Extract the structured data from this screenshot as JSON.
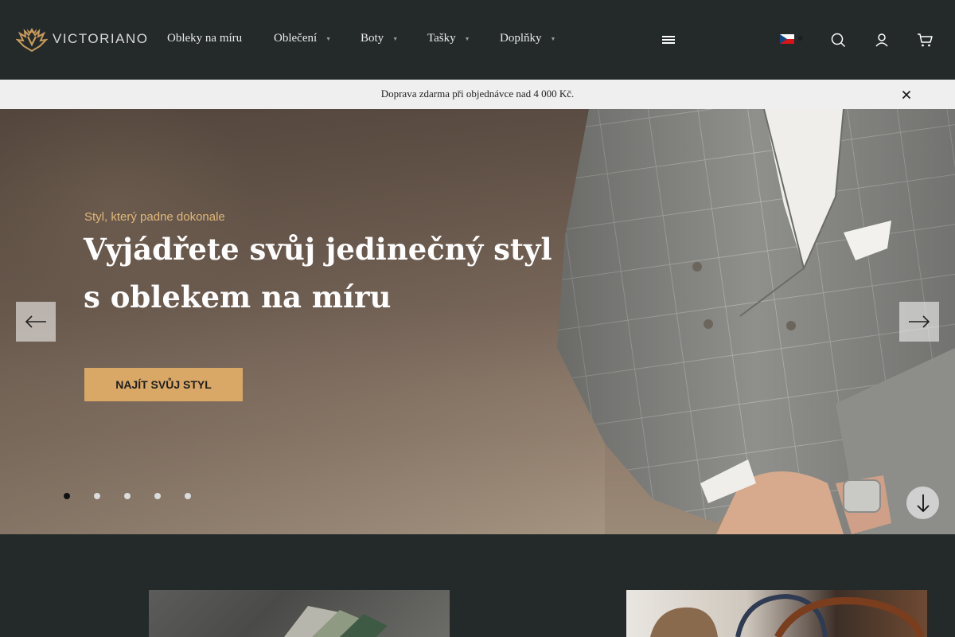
{
  "header": {
    "logo_text": "VICTORIANO",
    "nav": [
      {
        "label": "Obleky na míru",
        "has_dropdown": false
      },
      {
        "label": "Oblečení",
        "has_dropdown": true
      },
      {
        "label": "Boty",
        "has_dropdown": true
      },
      {
        "label": "Tašky",
        "has_dropdown": true
      },
      {
        "label": "Doplňky",
        "has_dropdown": true
      }
    ],
    "icons": [
      "menu-icon",
      "czech-flag-icon",
      "search-icon",
      "account-icon",
      "cart-icon"
    ]
  },
  "announcement": {
    "text": "Doprava zdarma při objednávce nad 4 000 Kč."
  },
  "hero": {
    "subtitle": "Styl, který padne dokonale",
    "title_line1": "Vyjádřete svůj jedinečný styl",
    "title_line2": "s oblekem na míru",
    "cta_label": "NAJÍT SVŮJ STYL",
    "slide_count": 5,
    "active_slide": 1
  },
  "colors": {
    "header_bg": "#242a2a",
    "accent": "#d9a867",
    "subtitle": "#e0b779",
    "announce_bg": "#efefef"
  }
}
